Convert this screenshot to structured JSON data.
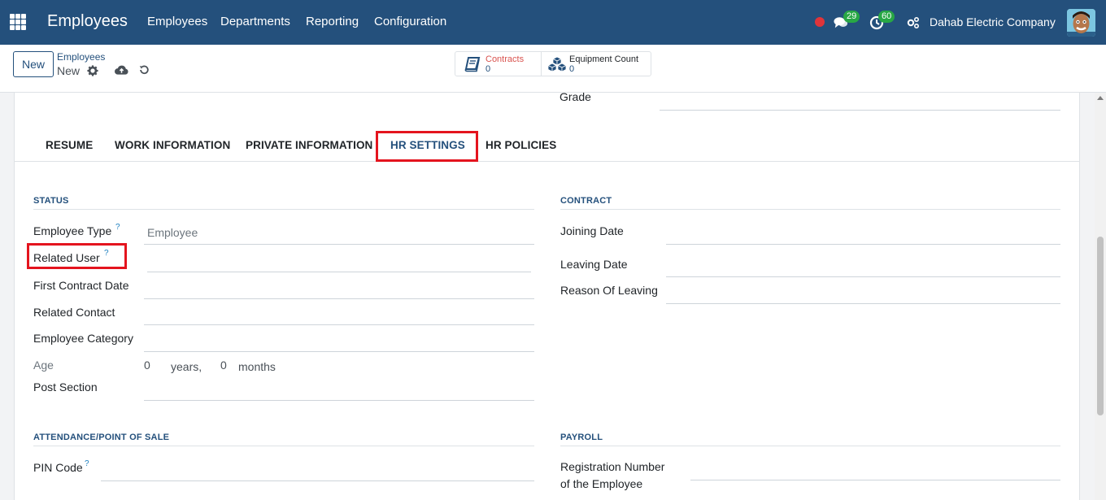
{
  "navbar": {
    "brand": "Employees",
    "menu": [
      "Employees",
      "Departments",
      "Reporting",
      "Configuration"
    ],
    "messages_count": "29",
    "activities_count": "60",
    "company": "Dahab Electric Company"
  },
  "control_panel": {
    "new_label": "New",
    "breadcrumb_parent": "Employees",
    "breadcrumb_current": "New",
    "smart_buttons": [
      {
        "label": "Contracts",
        "value": "0",
        "label_color": "#d9534f",
        "icon": "book-icon"
      },
      {
        "label": "Equipment Count",
        "value": "0",
        "label_color": "#212529",
        "icon": "cubes-icon"
      }
    ]
  },
  "form": {
    "grade_label": "Grade",
    "tabs": [
      "RESUME",
      "WORK INFORMATION",
      "PRIVATE INFORMATION",
      "HR SETTINGS",
      "HR POLICIES"
    ],
    "active_tab": "HR SETTINGS",
    "status": {
      "title": "STATUS",
      "employee_type_label": "Employee Type",
      "employee_type_value": "Employee",
      "related_user_label": "Related User",
      "first_contract_date_label": "First Contract Date",
      "related_contact_label": "Related Contact",
      "employee_category_label": "Employee Category",
      "age_label": "Age",
      "age_years_value": "0",
      "age_years_unit": "years,",
      "age_months_value": "0",
      "age_months_unit": "months",
      "post_section_label": "Post Section"
    },
    "contract": {
      "title": "CONTRACT",
      "joining_date_label": "Joining Date",
      "leaving_date_label": "Leaving Date",
      "reason_of_leaving_label": "Reason Of Leaving"
    },
    "attendance": {
      "title": "ATTENDANCE/POINT OF SALE",
      "pin_code_label": "PIN Code"
    },
    "payroll": {
      "title": "PAYROLL",
      "registration_number_label_1": "Registration Number",
      "registration_number_label_2": "of the Employee"
    },
    "help_mark": "?"
  },
  "colors": {
    "navbar": "#24507c",
    "highlight": "#e4141e",
    "badge": "#28a745",
    "status_dot": "#e0343a"
  }
}
